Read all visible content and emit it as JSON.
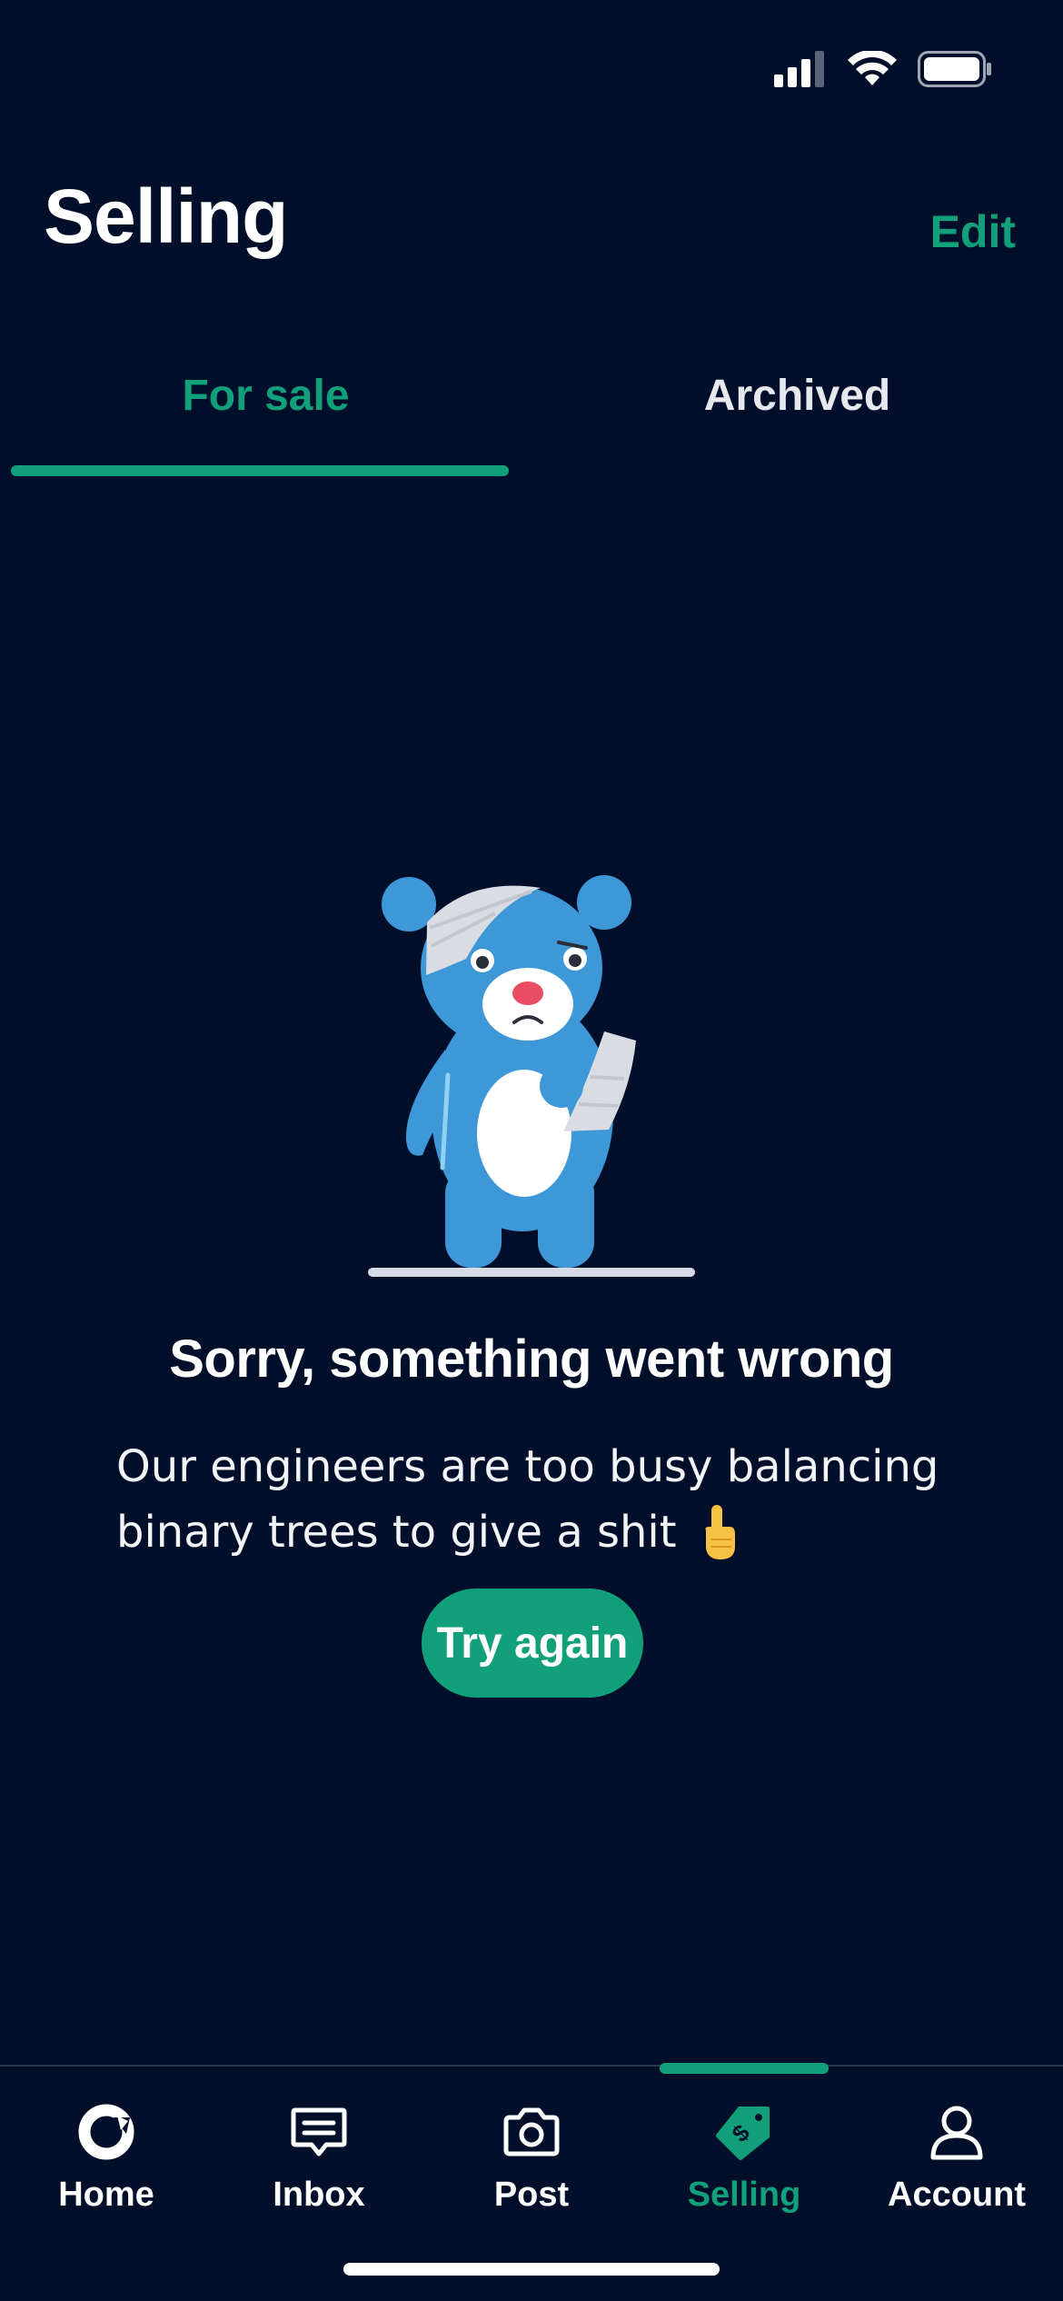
{
  "status_bar": {
    "icons": [
      "signal-icon",
      "wifi-icon",
      "battery-icon"
    ]
  },
  "header": {
    "title": "Selling",
    "edit_label": "Edit"
  },
  "tabs": [
    {
      "label": "For sale",
      "active": true
    },
    {
      "label": "Archived",
      "active": false
    }
  ],
  "error": {
    "illustration": "injured-bear-illustration",
    "title": "Sorry, something went wrong",
    "message_line1": "Our engineers are too busy balancing",
    "message_line2": "binary trees to give a shit",
    "message_emoji": "hand-pointing-up-icon",
    "button_label": "Try again"
  },
  "tabbar": {
    "items": [
      {
        "label": "Home",
        "icon": "home-icon",
        "active": false
      },
      {
        "label": "Inbox",
        "icon": "inbox-icon",
        "active": false
      },
      {
        "label": "Post",
        "icon": "camera-icon",
        "active": false
      },
      {
        "label": "Selling",
        "icon": "price-tag-icon",
        "active": true
      },
      {
        "label": "Account",
        "icon": "account-icon",
        "active": false
      }
    ]
  },
  "colors": {
    "background": "#020f2a",
    "accent": "#12a07a",
    "text": "#ffffff",
    "bear": "#3e97d6"
  }
}
